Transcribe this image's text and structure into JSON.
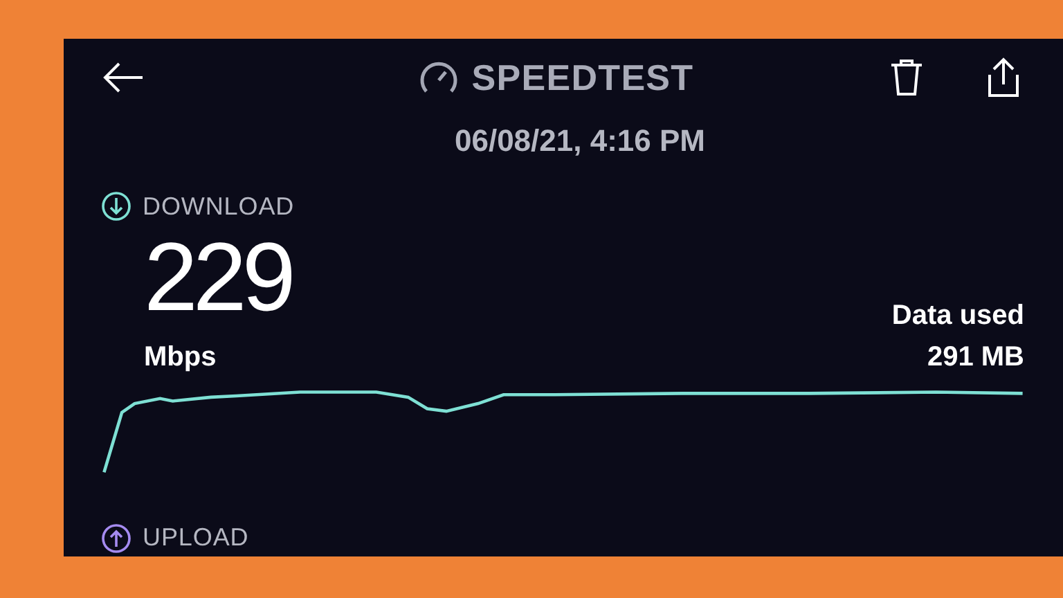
{
  "header": {
    "title": "SPEEDTEST",
    "date": "06/08/21, 4:16 PM"
  },
  "download": {
    "label": "DOWNLOAD",
    "value": "229",
    "unit": "Mbps"
  },
  "data_used": {
    "label": "Data used",
    "value": "291 MB"
  },
  "upload": {
    "label": "UPLOAD"
  }
}
